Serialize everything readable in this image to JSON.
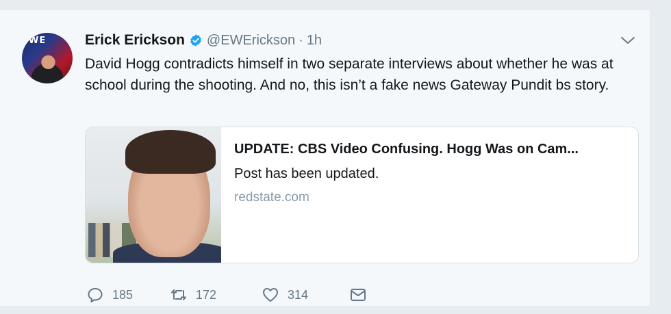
{
  "tweet": {
    "author_name": "Erick Erickson",
    "handle": "@EWErickson",
    "separator": "·",
    "time": "1h",
    "avatar_text": "WE",
    "text": "David Hogg contradicts himself in two separate interviews about whether he was at school during the shooting. And no, this isn’t a fake news Gateway Pundit bs story.",
    "verified_color": "#1da1f2"
  },
  "link_card": {
    "title": "UPDATE: CBS Video Confusing. Hogg Was on Cam...",
    "description": "Post has been updated.",
    "domain": "redstate.com"
  },
  "actions": {
    "reply_count": "185",
    "retweet_count": "172",
    "like_count": "314",
    "icons": [
      "reply-icon",
      "retweet-icon",
      "like-icon",
      "direct-message-icon"
    ]
  }
}
